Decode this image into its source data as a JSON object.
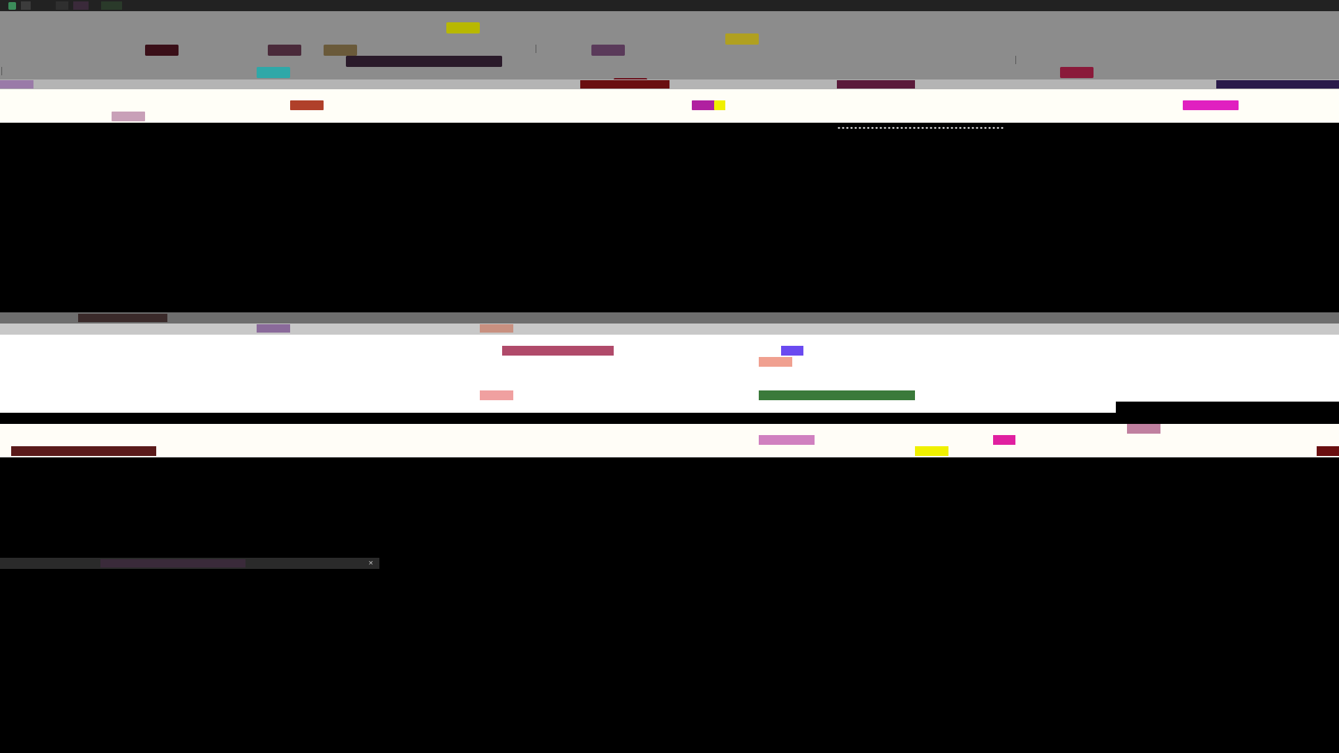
{
  "window_top": {
    "title": "",
    "toolbar_accent": "#b8b800",
    "tabs": []
  },
  "window_bottom": {
    "title": ""
  },
  "taskbar": {
    "items": []
  },
  "colors": {
    "toolbar_bg": "#8c8c8c",
    "content_bg": "#fffef7",
    "accent_yellow": "#f0f000",
    "accent_magenta": "#e0157f",
    "accent_teal": "#2fa8a8"
  },
  "icons": {
    "app": "app-icon",
    "menu": "menu-icon",
    "settings": "gear-icon",
    "close": "close-icon"
  }
}
